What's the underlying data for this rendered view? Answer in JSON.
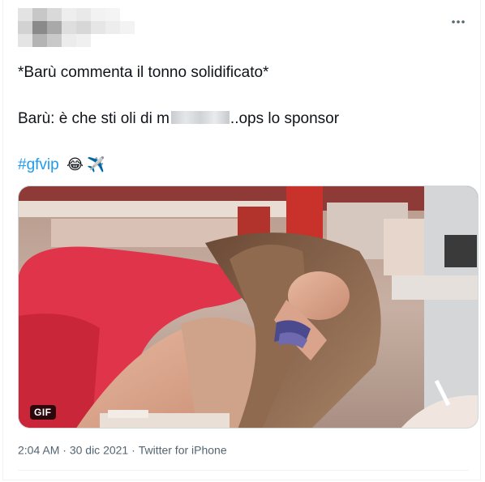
{
  "tweet": {
    "text_line1": "*Barù commenta il tonno solidificato*",
    "text_line2_before": "Barù: è che sti oli di m",
    "text_line2_after": "..ops lo sponsor",
    "hashtag": "#gfvip",
    "emoji_1": "😂",
    "emoji_2": "✈️"
  },
  "media": {
    "badge": "GIF"
  },
  "meta": {
    "time": "2:04 AM",
    "separator": "·",
    "date": "30 dic 2021",
    "source": "Twitter for iPhone"
  },
  "icons": {
    "more": "more-dots-icon",
    "avatar": "blurred-avatar",
    "censor": "censor-blur"
  },
  "colors": {
    "hashtag": "#1d9bf0",
    "meta_text": "#536471",
    "text": "#0f1419"
  }
}
